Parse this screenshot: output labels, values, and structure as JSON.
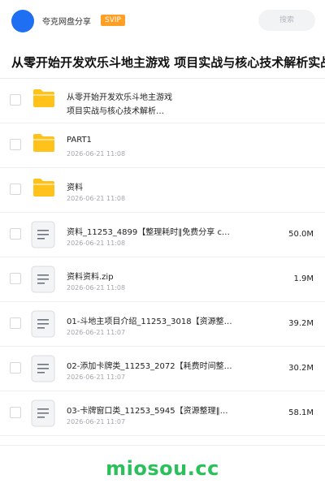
{
  "header": {
    "brand": "夸克网盘分享",
    "badge": "SVIP",
    "search_placeholder": "搜索"
  },
  "share": {
    "title": "从零开始开发欢乐斗地主游戏 项目实战与核心技术解析实战"
  },
  "items": [
    {
      "type": "folder",
      "name_line1": "从零开始开发欢乐斗地主游戏",
      "name_line2": "项目实战与核心技术解析…",
      "date": "",
      "size": ""
    },
    {
      "type": "folder",
      "name": "PART1",
      "date": "2026-06-21 11:08",
      "size": ""
    },
    {
      "type": "folder",
      "name": "资料",
      "date": "2026-06-21 11:08",
      "size": ""
    },
    {
      "type": "file",
      "name": "资料_11253_4899【整理耗时‖免费分享 c…",
      "date": "2026-06-21 11:08",
      "size": "50.0M"
    },
    {
      "type": "file",
      "name": "资料资料.zip",
      "date": "2026-06-21 11:08",
      "size": "1.9M"
    },
    {
      "type": "file",
      "name": "01-斗地主项目介绍_11253_3018【资源整…",
      "date": "2026-06-21 11:07",
      "size": "39.2M"
    },
    {
      "type": "file",
      "name": "02-添加卡牌类_11253_2072【耗费时间整…",
      "date": "2026-06-21 11:07",
      "size": "30.2M"
    },
    {
      "type": "file",
      "name": "03-卡牌窗口类_11253_5945【资源整理‖…",
      "date": "2026-06-21 11:07",
      "size": "58.1M"
    }
  ],
  "watermark": "miosou.cc",
  "colors": {
    "accent": "#1f6ff2",
    "svip": "#ff9f23",
    "folder": "#ffc21a",
    "watermark": "#2bc15a"
  }
}
